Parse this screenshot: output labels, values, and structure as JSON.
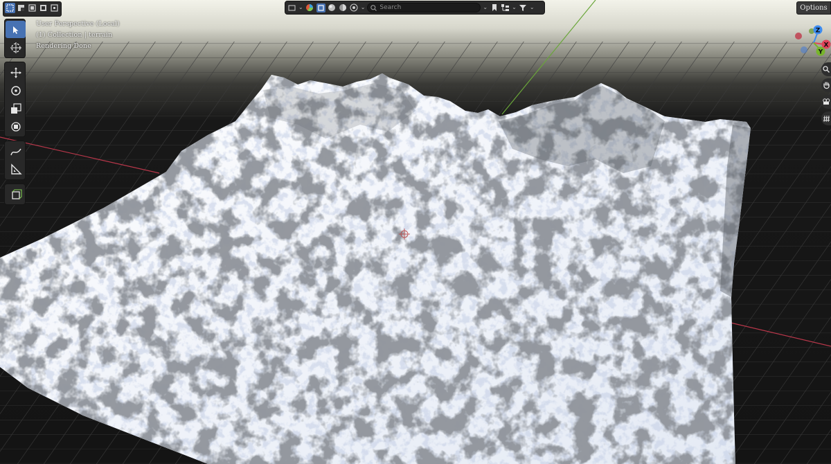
{
  "header": {
    "search_placeholder": "Search",
    "options_label": "Options"
  },
  "overlay": {
    "perspective": "User Perspective (Local)",
    "collection": "(1) Collection | terrain",
    "status": "Rendering Done"
  },
  "gizmo": {
    "z_label": "Z",
    "x_label": "X",
    "y_label": "Y"
  },
  "colors": {
    "accent": "#4772b3",
    "axis_x": "#e0455a",
    "axis_y": "#77b52b",
    "axis_z": "#3d8cf0",
    "grid": "#3a3a3a",
    "sky_top": "#f4f4ea",
    "snow": "#f6f8fc",
    "rock": "#4e5258"
  },
  "icons": {
    "toolbar": [
      "select-box-icon",
      "cursor-icon",
      "move-icon",
      "rotate-icon",
      "scale-icon",
      "transform-icon",
      "annotate-icon",
      "measure-icon",
      "add-cube-icon"
    ],
    "header_left": [
      "select-mode-new-icon",
      "select-mode-extend-icon",
      "select-mode-subtract-icon",
      "select-mode-invert-icon",
      "select-mode-intersect-icon"
    ],
    "header_center": [
      "view-layer-icon",
      "color-wheel-icon",
      "object-data-icon",
      "sphere-icon",
      "material-icon",
      "scene-icon",
      "search-icon",
      "bookmark-icon",
      "outliner-icon",
      "filter-icon"
    ],
    "navigation": [
      "zoom-icon",
      "pan-hand-icon",
      "camera-icon",
      "grid-ortho-icon"
    ]
  }
}
